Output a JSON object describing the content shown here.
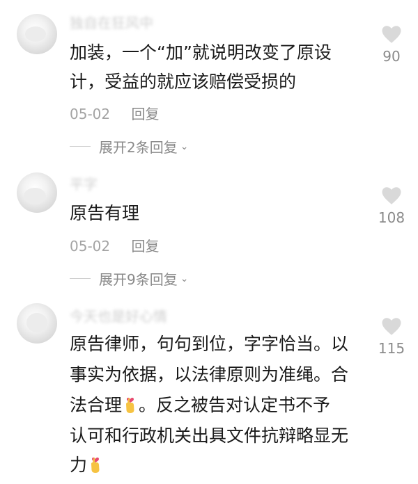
{
  "comments": [
    {
      "username": "独自在狂风中",
      "lines": [
        "加装，一个“加”就说明改变了原设",
        "计，受益的就应该赔偿受损的"
      ],
      "date": "05-02",
      "reply_label": "回复",
      "expand_label": "展开2条回复",
      "likes": "90"
    },
    {
      "username": "平字",
      "lines": [
        "原告有理"
      ],
      "date": "05-02",
      "reply_label": "回复",
      "expand_label": "展开9条回复",
      "likes": "108"
    },
    {
      "username": "今天也是好心情",
      "lines": [
        "原告律师，句句到位，字字恰当。以",
        "事实为依据，以法律原则为准绳。合",
        "法合理",
        "。反之被告对认定书不予",
        "认可和行政机关出具文件抗辩略显无",
        "力"
      ],
      "likes": "115"
    }
  ],
  "icons": {
    "heart": "heart-icon",
    "chevron": "chevron-down-icon",
    "emoji": "crossed-fingers-heart-emoji"
  }
}
